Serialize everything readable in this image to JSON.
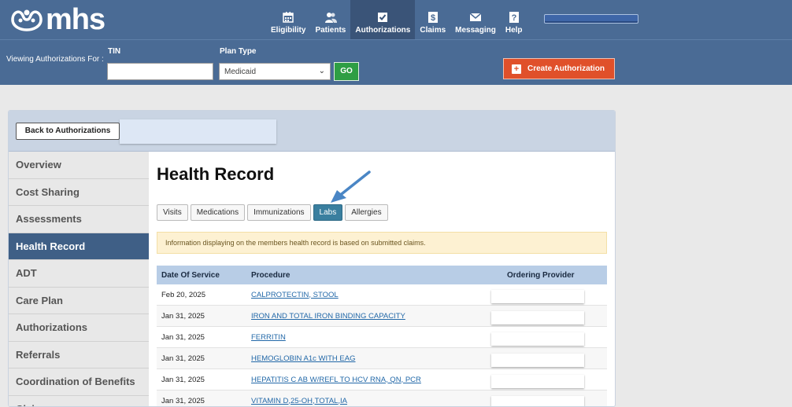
{
  "app": {
    "logo_text": "mhs"
  },
  "nav": [
    {
      "label": "Eligibility",
      "icon": "calendar-icon"
    },
    {
      "label": "Patients",
      "icon": "patients-icon"
    },
    {
      "label": "Authorizations",
      "icon": "checkbox-icon",
      "active": true
    },
    {
      "label": "Claims",
      "icon": "dollar-icon"
    },
    {
      "label": "Messaging",
      "icon": "envelope-icon"
    },
    {
      "label": "Help",
      "icon": "question-icon"
    }
  ],
  "filter": {
    "viewing_label": "Viewing Authorizations For :",
    "tin_label": "TIN",
    "tin_value": "",
    "plan_type_label": "Plan Type",
    "plan_type_value": "Medicaid",
    "go_label": "GO",
    "create_label": "Create Authorization"
  },
  "panel": {
    "back_label": "Back to Authorizations"
  },
  "sidebar": [
    {
      "label": "Overview"
    },
    {
      "label": "Cost Sharing"
    },
    {
      "label": "Assessments"
    },
    {
      "label": "Health Record",
      "active": true
    },
    {
      "label": "ADT"
    },
    {
      "label": "Care Plan"
    },
    {
      "label": "Authorizations"
    },
    {
      "label": "Referrals"
    },
    {
      "label": "Coordination of Benefits"
    },
    {
      "label": "Claims"
    }
  ],
  "main": {
    "title": "Health Record",
    "tabs": [
      {
        "label": "Visits"
      },
      {
        "label": "Medications"
      },
      {
        "label": "Immunizations"
      },
      {
        "label": "Labs",
        "active": true
      },
      {
        "label": "Allergies"
      }
    ],
    "notice": "Information displaying on the members health record is based on submitted claims.",
    "columns": [
      "Date Of Service",
      "Procedure",
      "Ordering Provider"
    ],
    "rows": [
      {
        "date": "Feb 20, 2025",
        "procedure": "CALPROTECTIN, STOOL"
      },
      {
        "date": "Jan 31, 2025",
        "procedure": "IRON AND TOTAL IRON BINDING CAPACITY"
      },
      {
        "date": "Jan 31, 2025",
        "procedure": "FERRITIN"
      },
      {
        "date": "Jan 31, 2025",
        "procedure": "HEMOGLOBIN A1c WITH EAG"
      },
      {
        "date": "Jan 31, 2025",
        "procedure": "HEPATITIS C AB W/REFL TO HCV RNA, QN, PCR"
      },
      {
        "date": "Jan 31, 2025",
        "procedure": "VITAMIN D,25-OH,TOTAL,IA"
      }
    ]
  },
  "colors": {
    "header_bg": "#4a6b95",
    "active_side": "#3f5f86",
    "tab_active": "#3a7f9f",
    "create_btn": "#e0502a",
    "go_btn": "#2e9e44"
  }
}
